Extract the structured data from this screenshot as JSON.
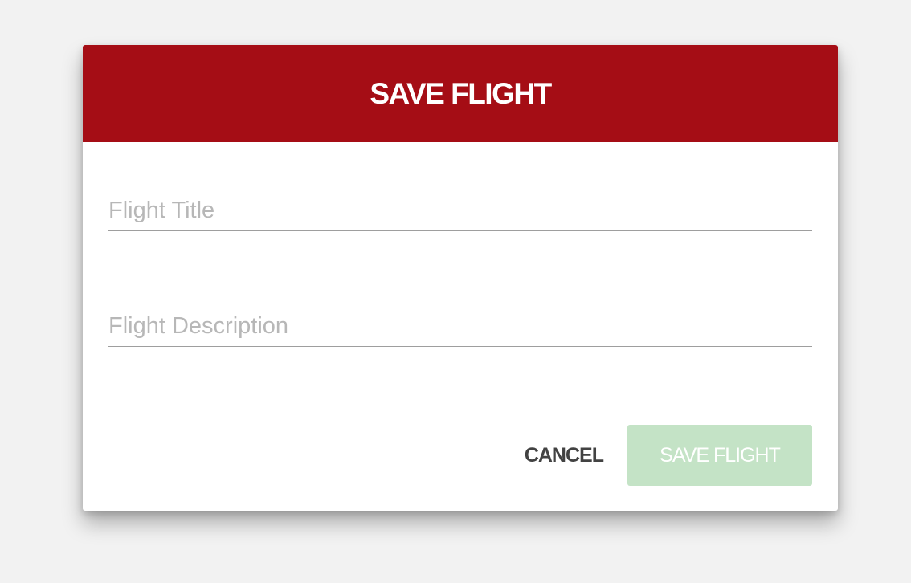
{
  "dialog": {
    "title": "SAVE FLIGHT",
    "header_color": "#a50d15",
    "fields": {
      "title": {
        "value": "",
        "placeholder": "Flight Title"
      },
      "description": {
        "value": "",
        "placeholder": "Flight Description"
      }
    },
    "actions": {
      "cancel_label": "CANCEL",
      "save_label": "SAVE FLIGHT",
      "save_disabled": true,
      "save_color": "#c4e3c6"
    }
  }
}
